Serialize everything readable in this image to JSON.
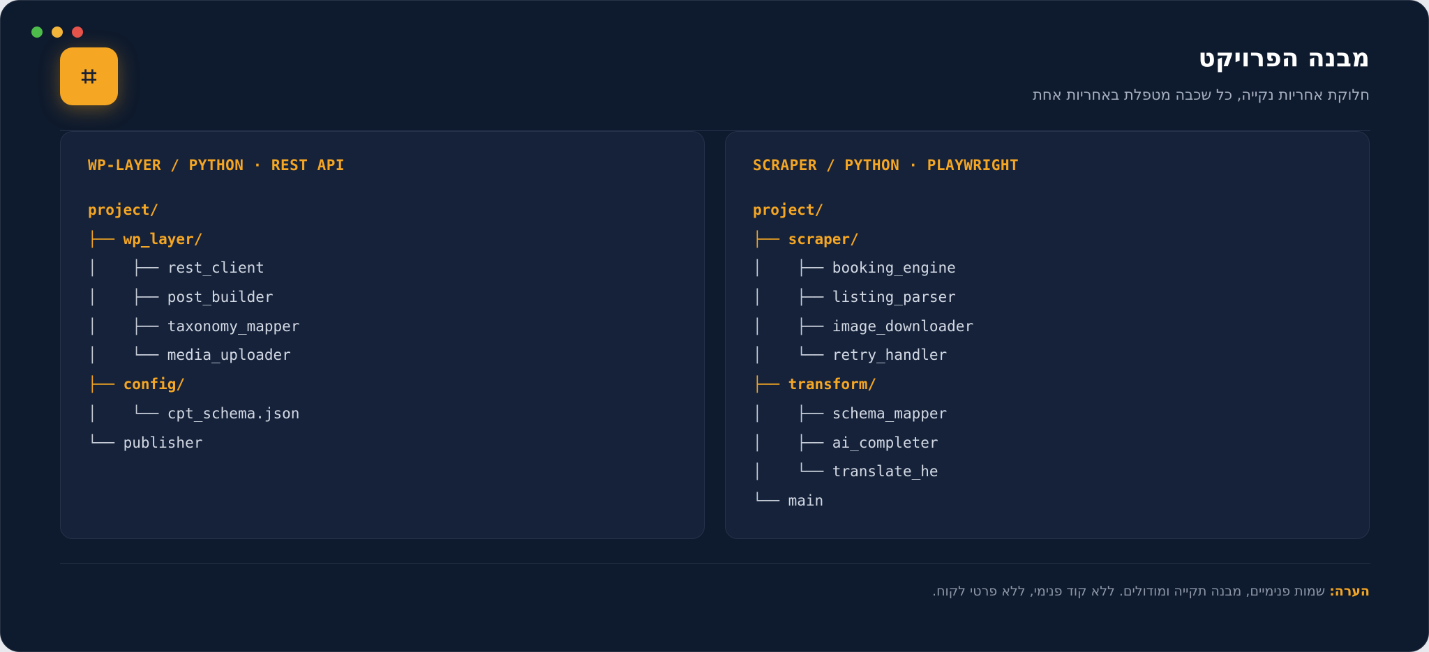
{
  "header": {
    "title": "מבנה הפרויקט",
    "subtitle": "חלוקת אחריות נקייה, כל שכבה מטפלת באחריות אחת",
    "badge_icon": "hash-icon",
    "badge_glyph": "⌗"
  },
  "colors": {
    "accent": "#f5a623",
    "background": "#0e1a2d",
    "panel": "#15223a"
  },
  "panels": [
    {
      "heading": "WP-LAYER / PYTHON · REST API",
      "lines": [
        {
          "prefix": "",
          "name": "project/"
        },
        {
          "prefix": "├── ",
          "name": "wp_layer/"
        },
        {
          "prefix": "│    ├── ",
          "name": "rest_client"
        },
        {
          "prefix": "│    ├── ",
          "name": "post_builder"
        },
        {
          "prefix": "│    ├── ",
          "name": "taxonomy_mapper"
        },
        {
          "prefix": "│    └── ",
          "name": "media_uploader"
        },
        {
          "prefix": "├── ",
          "name": "config/"
        },
        {
          "prefix": "│    └── ",
          "name": "cpt_schema.json"
        },
        {
          "prefix": "└── ",
          "name": "publisher"
        }
      ]
    },
    {
      "heading": "SCRAPER / PYTHON · PLAYWRIGHT",
      "lines": [
        {
          "prefix": "",
          "name": "project/"
        },
        {
          "prefix": "├── ",
          "name": "scraper/"
        },
        {
          "prefix": "│    ├── ",
          "name": "booking_engine"
        },
        {
          "prefix": "│    ├── ",
          "name": "listing_parser"
        },
        {
          "prefix": "│    ├── ",
          "name": "image_downloader"
        },
        {
          "prefix": "│    └── ",
          "name": "retry_handler"
        },
        {
          "prefix": "├── ",
          "name": "transform/"
        },
        {
          "prefix": "│    ├── ",
          "name": "schema_mapper"
        },
        {
          "prefix": "│    ├── ",
          "name": "ai_completer"
        },
        {
          "prefix": "│    └── ",
          "name": "translate_he"
        },
        {
          "prefix": "└── ",
          "name": "main"
        }
      ]
    }
  ],
  "footer": {
    "note_label": "הערה:",
    "note_text": " שמות פנימיים, מבנה תקייה ומודולים. ללא קוד פנימי, ללא פרטי לקוח."
  }
}
